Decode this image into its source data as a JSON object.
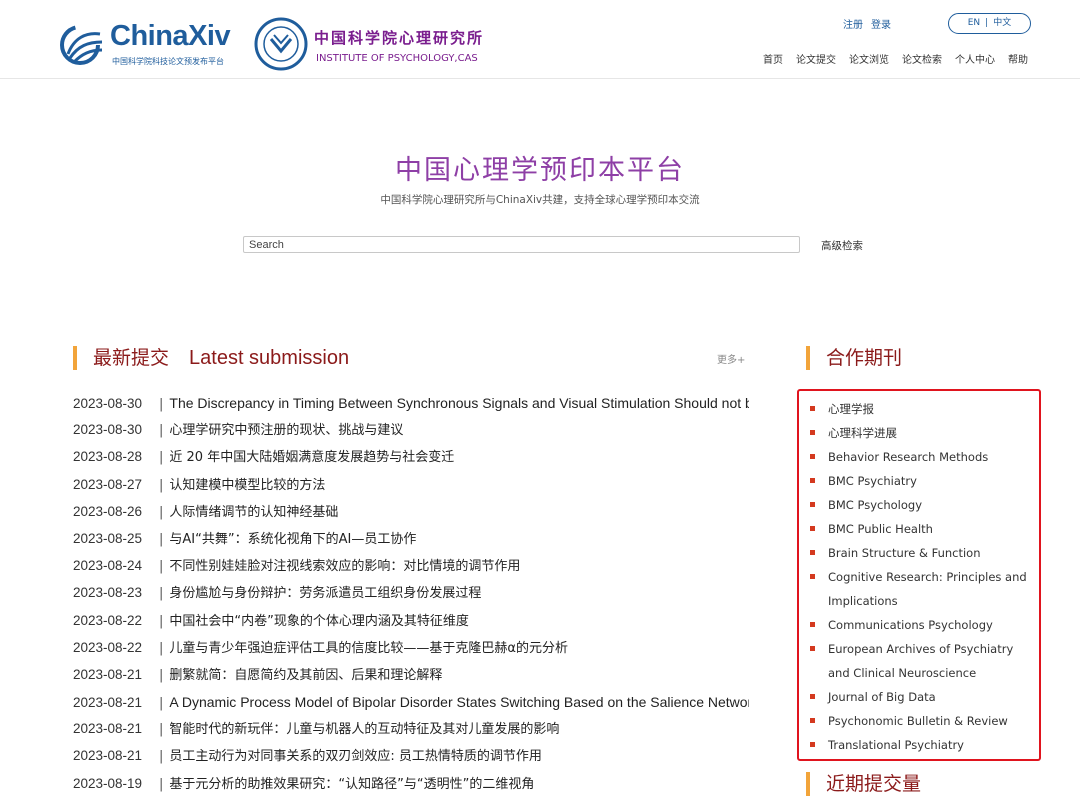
{
  "header": {
    "chinaxiv_logo": {
      "name_prefix": "China",
      "name_suffix": "Xiv",
      "subtitle": "中国科学院科技论文预发布平台"
    },
    "institute_logo": {
      "name_cn": "中国科学院心理研究所",
      "name_en": "INSTITUTE OF PSYCHOLOGY,CAS"
    },
    "auth": {
      "register": "注册",
      "login": "登录"
    },
    "lang": {
      "en": "EN",
      "separator": "|",
      "cn": "中文"
    },
    "nav": [
      "首页",
      "论文提交",
      "论文浏览",
      "论文检索",
      "个人中心",
      "帮助"
    ]
  },
  "hero": {
    "title": "中国心理学预印本平台",
    "subtitle": "中国科学院心理研究所与ChinaXiv共建，支持全球心理学预印本交流",
    "search_placeholder": "Search",
    "advanced_search": "高级检索"
  },
  "latest": {
    "title_cn": "最新提交",
    "title_en": "Latest submission",
    "more": "更多+",
    "separator": "|",
    "items": [
      {
        "date": "2023-08-30",
        "title": "The Discrepancy in Timing Between Synchronous Signals and Visual Stimulation Should not be",
        "lang": "en"
      },
      {
        "date": "2023-08-30",
        "title": "心理学研究中预注册的现状、挑战与建议",
        "lang": "cn"
      },
      {
        "date": "2023-08-28",
        "title": "近 20 年中国大陆婚姻满意度发展趋势与社会变迁",
        "lang": "cn"
      },
      {
        "date": "2023-08-27",
        "title": "认知建模中模型比较的方法",
        "lang": "cn"
      },
      {
        "date": "2023-08-26",
        "title": "人际情绪调节的认知神经基础",
        "lang": "cn"
      },
      {
        "date": "2023-08-25",
        "title": "与AI“共舞”：系统化视角下的AI—员工协作",
        "lang": "cn"
      },
      {
        "date": "2023-08-24",
        "title": "不同性别娃娃脸对注视线索效应的影响：对比情境的调节作用",
        "lang": "cn"
      },
      {
        "date": "2023-08-23",
        "title": "身份尴尬与身份辩护：劳务派遣员工组织身份发展过程",
        "lang": "cn"
      },
      {
        "date": "2023-08-22",
        "title": "中国社会中“内卷”现象的个体心理内涵及其特征维度",
        "lang": "cn"
      },
      {
        "date": "2023-08-22",
        "title": "儿童与青少年强迫症评估工具的信度比较——基于克隆巴赫α的元分析",
        "lang": "cn"
      },
      {
        "date": "2023-08-21",
        "title": "删繁就简：自愿简约及其前因、后果和理论解释",
        "lang": "cn"
      },
      {
        "date": "2023-08-21",
        "title": "A Dynamic Process Model of Bipolar Disorder States Switching Based on the Salience Network",
        "lang": "en"
      },
      {
        "date": "2023-08-21",
        "title": "智能时代的新玩伴：儿童与机器人的互动特征及其对儿童发展的影响",
        "lang": "cn"
      },
      {
        "date": "2023-08-21",
        "title": "员工主动行为对同事关系的双刃剑效应: 员工热情特质的调节作用",
        "lang": "cn"
      },
      {
        "date": "2023-08-19",
        "title": "基于元分析的助推效果研究：“认知路径”与“透明性”的二维视角",
        "lang": "cn"
      }
    ]
  },
  "partners": {
    "title": "合作期刊",
    "items": [
      "心理学报",
      "心理科学进展",
      "Behavior Research Methods",
      "BMC Psychiatry",
      "BMC Psychology",
      "BMC Public Health",
      "Brain Structure & Function",
      "Cognitive Research: Principles and Implications",
      "Communications Psychology",
      "European Archives of Psychiatry and Clinical Neuroscience",
      "Journal of Big Data",
      "Psychonomic Bulletin & Review",
      "Translational Psychiatry"
    ],
    "accent_color": "#d4391f",
    "highlight_border_color": "#e0141e"
  },
  "recent": {
    "title": "近期提交量"
  },
  "colors": {
    "brand_blue": "#1f5d9c",
    "title_purple": "#8e3fa6",
    "section_red": "#8b1a1a",
    "section_bar": "#f2a43a"
  }
}
